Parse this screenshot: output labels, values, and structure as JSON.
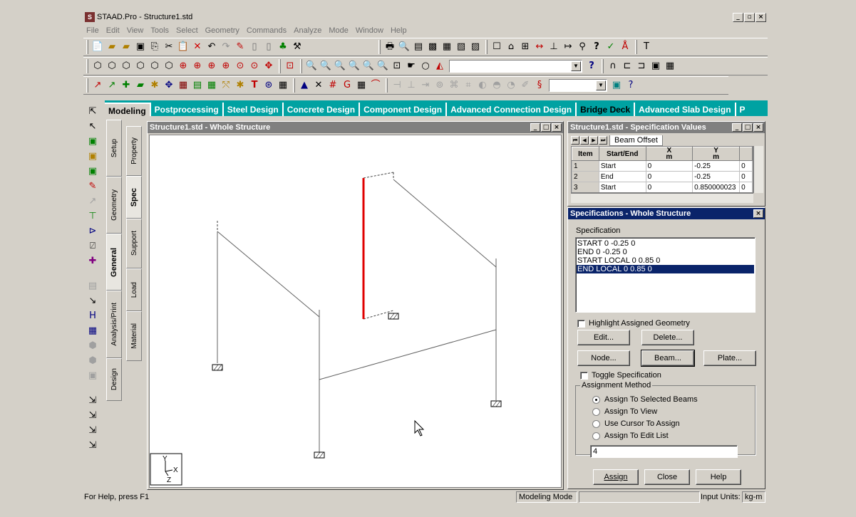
{
  "window": {
    "title": "STAAD.Pro - Structure1.std"
  },
  "menu": [
    "File",
    "Edit",
    "View",
    "Tools",
    "Select",
    "Geometry",
    "Commands",
    "Analyze",
    "Mode",
    "Window",
    "Help"
  ],
  "tabs": [
    {
      "label": "Modeling",
      "active": true
    },
    {
      "label": "Postprocessing"
    },
    {
      "label": "Steel Design"
    },
    {
      "label": "Concrete Design"
    },
    {
      "label": "Component Design"
    },
    {
      "label": "Advanced Connection Design"
    },
    {
      "label": "Bridge Deck",
      "highlight": true
    },
    {
      "label": "Advanced Slab Design"
    },
    {
      "label": "P"
    }
  ],
  "vtabs_outer": [
    "Setup",
    "Geometry",
    "General",
    "Analysis/Print",
    "Design"
  ],
  "vtabs_inner": [
    "Property",
    "Spec",
    "Support",
    "Load",
    "Material"
  ],
  "structure_window": {
    "title": "Structure1.std - Whole Structure",
    "axes": {
      "y": "Y",
      "x": "X",
      "z": "Z"
    }
  },
  "spec_values_window": {
    "title": "Structure1.std - Specification Values",
    "sheet_tab": "Beam Offset",
    "headers": [
      "Item",
      "Start/End",
      "X",
      "Y",
      ""
    ],
    "units": [
      "",
      "",
      "m",
      "m",
      ""
    ],
    "rows": [
      [
        "1",
        "Start",
        "0",
        "-0.25",
        "0"
      ],
      [
        "2",
        "End",
        "0",
        "-0.25",
        "0"
      ],
      [
        "3",
        "Start",
        "0",
        "0.850000023",
        "0"
      ]
    ]
  },
  "spec_dialog": {
    "title": "Specifications - Whole Structure",
    "list_label": "Specification",
    "items": [
      "START 0 -0.25 0",
      "END 0 -0.25 0",
      "START LOCAL 0 0.85 0",
      "END LOCAL 0 0.85 0"
    ],
    "selected_index": 3,
    "highlight_label": "Highlight Assigned Geometry",
    "edit": "Edit...",
    "delete": "Delete...",
    "node": "Node...",
    "beam": "Beam...",
    "plate": "Plate...",
    "toggle_label": "Toggle Specification",
    "assignment_group": "Assignment Method",
    "radios": [
      "Assign To Selected Beams",
      "Assign To View",
      "Use Cursor To Assign",
      "Assign To Edit List"
    ],
    "radio_selected": 0,
    "edit_list_value": "4",
    "assign": "Assign",
    "close": "Close",
    "help": "Help"
  },
  "status": {
    "help": "For Help, press F1",
    "mode": "Modeling Mode",
    "units_label": "Input Units:",
    "units": "kg-m"
  }
}
